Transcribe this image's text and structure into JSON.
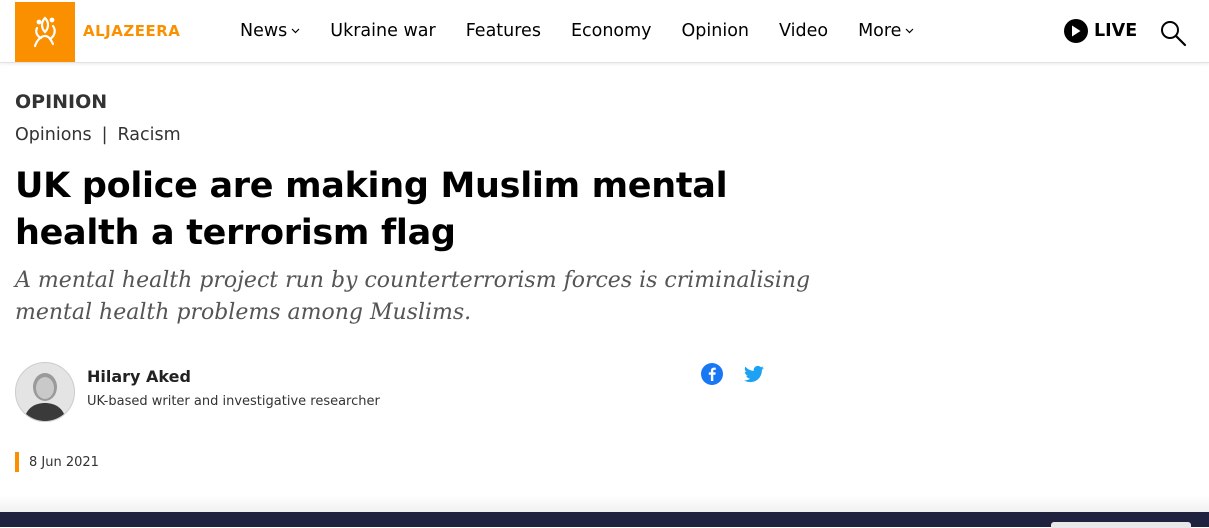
{
  "brand": {
    "logo_text": "ALJAZEERA",
    "accent": "#fa9000"
  },
  "nav": {
    "items": [
      {
        "label": "News",
        "dropdown": true
      },
      {
        "label": "Ukraine war",
        "dropdown": false
      },
      {
        "label": "Features",
        "dropdown": false
      },
      {
        "label": "Economy",
        "dropdown": false
      },
      {
        "label": "Opinion",
        "dropdown": false
      },
      {
        "label": "Video",
        "dropdown": false
      },
      {
        "label": "More",
        "dropdown": true
      }
    ],
    "live_label": "LIVE",
    "icons": {
      "live": "play-icon",
      "search": "search-icon",
      "dropdown": "chevron-down-icon"
    }
  },
  "article": {
    "section": "OPINION",
    "breadcrumbs": [
      "Opinions",
      "Racism"
    ],
    "breadcrumb_separator": "|",
    "headline": "UK police are making Muslim mental health a terrorism flag",
    "dek": "A mental health project run by counterterrorism forces is criminalising mental health problems among Muslims.",
    "author": {
      "name": "Hilary Aked",
      "role": "UK-based writer and investigative researcher"
    },
    "share": [
      "facebook-icon",
      "twitter-icon"
    ],
    "date": "8 Jun 2021"
  },
  "colors": {
    "facebook": "#1877f2",
    "twitter": "#1da1f2",
    "footer": "#20223f"
  }
}
